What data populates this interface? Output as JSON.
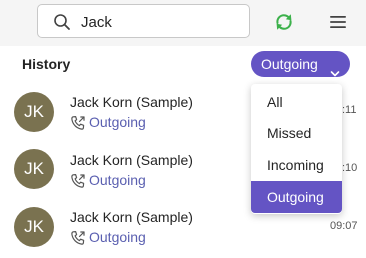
{
  "search": {
    "value": "Jack"
  },
  "history": {
    "title": "History",
    "filter": {
      "selected": "Outgoing",
      "options": [
        "All",
        "Missed",
        "Incoming",
        "Outgoing"
      ]
    }
  },
  "calls": [
    {
      "initials": "JK",
      "name": "Jack Korn (Sample)",
      "type": "Outgoing",
      "time": ":11"
    },
    {
      "initials": "JK",
      "name": "Jack Korn (Sample)",
      "type": "Outgoing",
      "time": ":10"
    },
    {
      "initials": "JK",
      "name": "Jack Korn (Sample)",
      "type": "Outgoing",
      "time": "09:07"
    }
  ],
  "colors": {
    "accent": "#6454c4",
    "avatar": "#7a7250",
    "refresh": "#3cb14b",
    "call_type": "#5a5fb0"
  },
  "icons": {
    "search": "search-icon",
    "refresh": "refresh-icon",
    "menu": "hamburger-menu-icon",
    "dropdown": "chevron-down-icon",
    "call": "outgoing-call-icon"
  }
}
